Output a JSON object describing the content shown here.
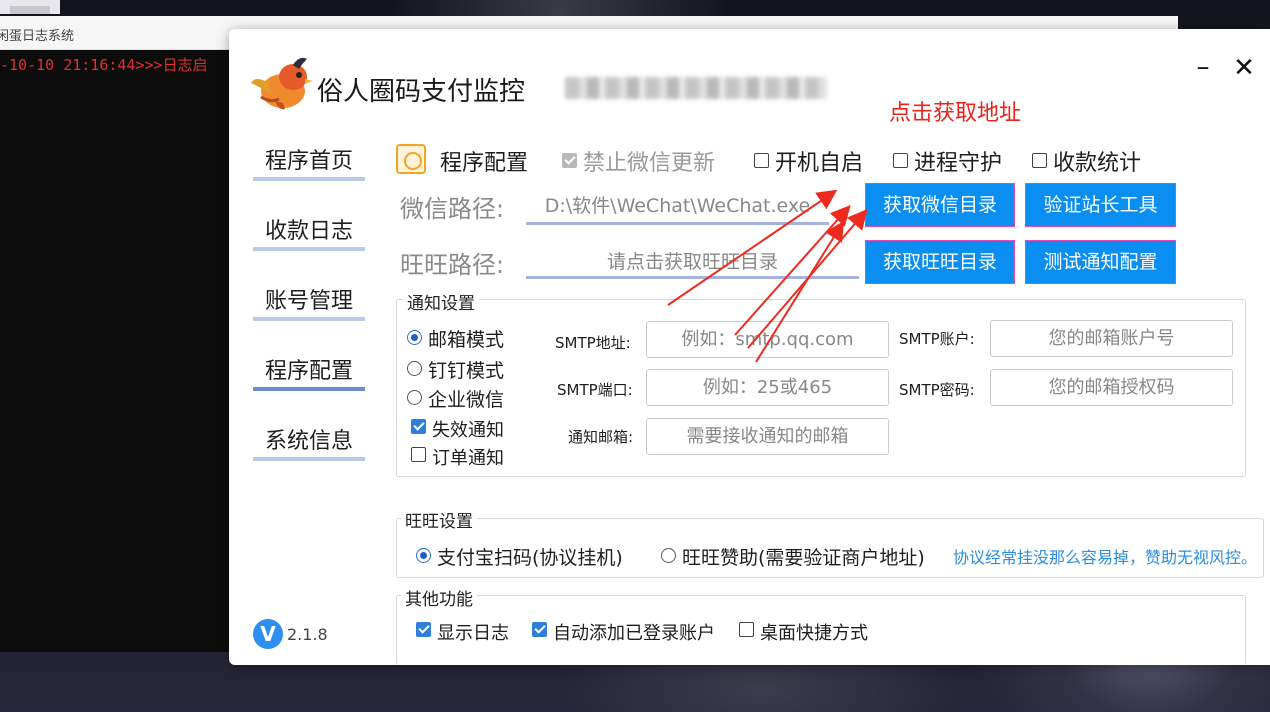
{
  "console": {
    "title": "闲蛋日志系统",
    "log_line": "-10-10 21:16:44>>>日志启"
  },
  "app": {
    "title": "俗人圈码支付监控",
    "annotation": "点击获取地址",
    "minimize_icon": "minimize-icon",
    "close_icon": "close-icon"
  },
  "sidebar": {
    "items": [
      {
        "label": "程序首页",
        "active": false
      },
      {
        "label": "收款日志",
        "active": false
      },
      {
        "label": "账号管理",
        "active": false
      },
      {
        "label": "程序配置",
        "active": true
      },
      {
        "label": "系统信息",
        "active": false
      }
    ],
    "version_badge": "V",
    "version": "2.1.8"
  },
  "header": {
    "title": "程序配置",
    "disable_wechat_update": {
      "label": "禁止微信更新",
      "checked": true,
      "disabled": true
    },
    "autostart": {
      "label": "开机自启",
      "checked": false
    },
    "process_guard": {
      "label": "进程守护",
      "checked": false
    },
    "payment_stats": {
      "label": "收款统计",
      "checked": false
    }
  },
  "paths": {
    "wechat_label": "微信路径:",
    "wechat_value": "D:\\软件\\WeChat\\WeChat.exe",
    "wangwang_label": "旺旺路径:",
    "wangwang_placeholder": "请点击获取旺旺目录",
    "btn_get_wechat_dir": "获取微信目录",
    "btn_verify_tool": "验证站长工具",
    "btn_get_wangwang_dir": "获取旺旺目录",
    "btn_test_notify": "测试通知配置"
  },
  "notify": {
    "group_title": "通知设置",
    "modes": [
      {
        "label": "邮箱模式",
        "selected": true
      },
      {
        "label": "钉钉模式",
        "selected": false
      },
      {
        "label": "企业微信",
        "selected": false
      }
    ],
    "fail_notify": {
      "label": "失效通知",
      "checked": true
    },
    "order_notify": {
      "label": "订单通知",
      "checked": false
    },
    "smtp_address_label": "SMTP地址:",
    "smtp_address_placeholder": "例如：smtp.qq.com",
    "smtp_account_label": "SMTP账户:",
    "smtp_account_placeholder": "您的邮箱账户号",
    "smtp_port_label": "SMTP端口:",
    "smtp_port_placeholder": "例如：25或465",
    "smtp_password_label": "SMTP密码:",
    "smtp_password_placeholder": "您的邮箱授权码",
    "notify_email_label": "通知邮箱:",
    "notify_email_placeholder": "需要接收通知的邮箱"
  },
  "wangwang": {
    "group_title": "旺旺设置",
    "options": [
      {
        "label": "支付宝扫码(协议挂机)",
        "selected": true
      },
      {
        "label": "旺旺赞助(需要验证商户地址)",
        "selected": false
      }
    ],
    "hint": "协议经常挂没那么容易掉，赞助无视风控。"
  },
  "other": {
    "group_title": "其他功能",
    "show_log": {
      "label": "显示日志",
      "checked": true
    },
    "auto_add_account": {
      "label": "自动添加已登录账户",
      "checked": true
    },
    "desktop_shortcut": {
      "label": "桌面快捷方式",
      "checked": false
    }
  },
  "colors": {
    "button_blue": "#0b8ef1",
    "annotation_red": "#e8251b",
    "nav_underline": "#b9c9e8",
    "nav_underline_active": "#6d8bd0",
    "hint_blue": "#2a8de0"
  }
}
